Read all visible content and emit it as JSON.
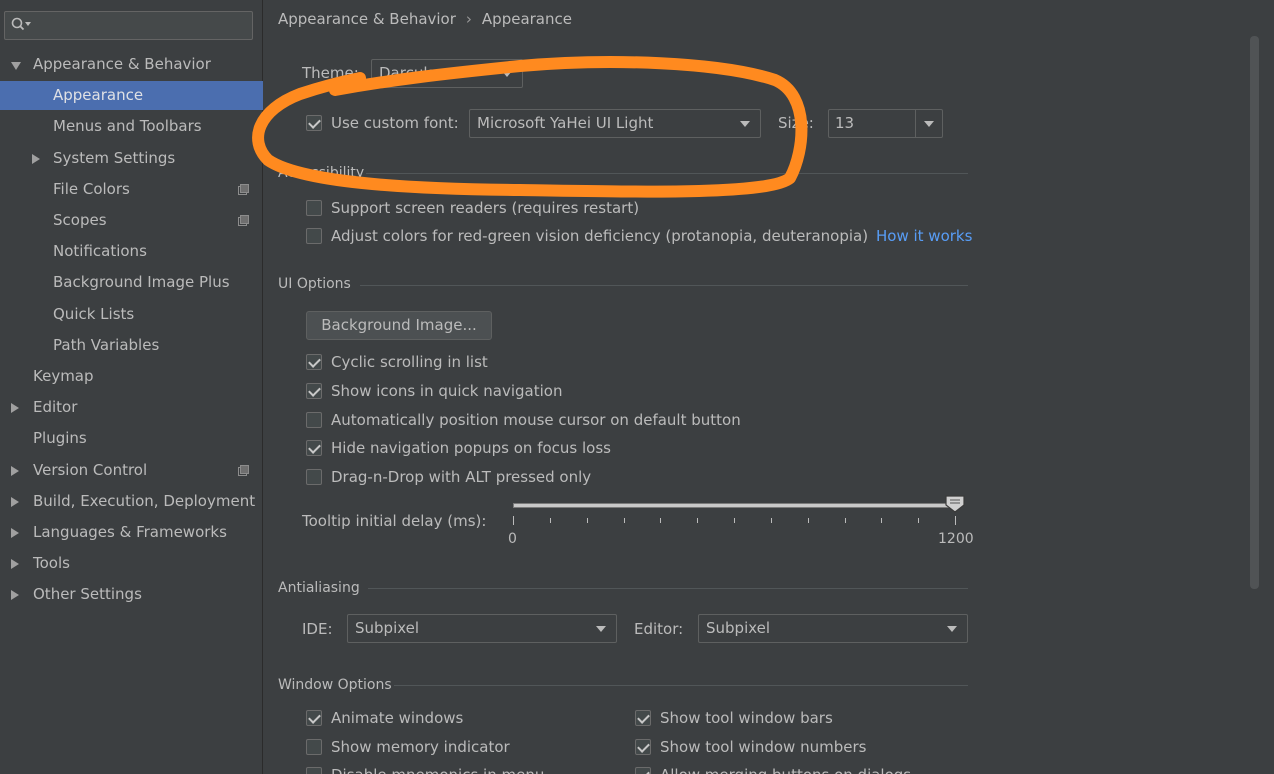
{
  "sidebar": {
    "search": {
      "placeholder": "",
      "icon": "search-icon"
    },
    "items": [
      {
        "label": "Appearance & Behavior",
        "level": 0,
        "arrow": "expanded"
      },
      {
        "label": "Appearance",
        "level": 1,
        "selected": true
      },
      {
        "label": "Menus and Toolbars",
        "level": 1
      },
      {
        "label": "System Settings",
        "level": 1,
        "arrow": "collapsed"
      },
      {
        "label": "File Colors",
        "level": 1,
        "project_icon": true
      },
      {
        "label": "Scopes",
        "level": 1,
        "project_icon": true
      },
      {
        "label": "Notifications",
        "level": 1
      },
      {
        "label": "Background Image Plus",
        "level": 1
      },
      {
        "label": "Quick Lists",
        "level": 1
      },
      {
        "label": "Path Variables",
        "level": 1
      },
      {
        "label": "Keymap",
        "level": 0
      },
      {
        "label": "Editor",
        "level": 0,
        "arrow": "collapsed"
      },
      {
        "label": "Plugins",
        "level": 0
      },
      {
        "label": "Version Control",
        "level": 0,
        "arrow": "collapsed",
        "project_icon": true
      },
      {
        "label": "Build, Execution, Deployment",
        "level": 0,
        "arrow": "collapsed"
      },
      {
        "label": "Languages & Frameworks",
        "level": 0,
        "arrow": "collapsed"
      },
      {
        "label": "Tools",
        "level": 0,
        "arrow": "collapsed"
      },
      {
        "label": "Other Settings",
        "level": 0,
        "arrow": "collapsed"
      }
    ]
  },
  "breadcrumb": {
    "parent": "Appearance & Behavior",
    "separator": "›",
    "current": "Appearance"
  },
  "theme": {
    "label": "Theme:",
    "value": "Darcula"
  },
  "custom_font": {
    "label": "Use custom font:",
    "checked": true,
    "font": "Microsoft YaHei UI Light",
    "size_label": "Size:",
    "size": "13"
  },
  "accessibility": {
    "title": "Accessibility",
    "screen_readers": {
      "label": "Support screen readers (requires restart)",
      "checked": false
    },
    "adjust_colors": {
      "label": "Adjust colors for red-green vision deficiency (protanopia, deuteranopia)",
      "checked": false,
      "link": "How it works"
    }
  },
  "ui_options": {
    "title": "UI Options",
    "background_button": "Background Image...",
    "checkboxes": [
      {
        "label": "Cyclic scrolling in list",
        "checked": true
      },
      {
        "label": "Show icons in quick navigation",
        "checked": true
      },
      {
        "label": "Automatically position mouse cursor on default button",
        "checked": false
      },
      {
        "label": "Hide navigation popups on focus loss",
        "checked": true
      },
      {
        "label": "Drag-n-Drop with ALT pressed only",
        "checked": false
      }
    ],
    "tooltip_delay": {
      "label": "Tooltip initial delay (ms):",
      "min": "0",
      "max": "1200",
      "value": 1200
    }
  },
  "antialiasing": {
    "title": "Antialiasing",
    "ide_label": "IDE:",
    "ide_value": "Subpixel",
    "editor_label": "Editor:",
    "editor_value": "Subpixel"
  },
  "window_options": {
    "title": "Window Options",
    "left": [
      {
        "label": "Animate windows",
        "checked": true
      },
      {
        "label": "Show memory indicator",
        "checked": false
      },
      {
        "label": "Disable mnemonics in menu",
        "checked": false
      }
    ],
    "right": [
      {
        "label": "Show tool window bars",
        "checked": true
      },
      {
        "label": "Show tool window numbers",
        "checked": true
      },
      {
        "label": "Allow merging buttons on dialogs",
        "checked": true
      }
    ]
  },
  "colors": {
    "selection": "#4b6eaf",
    "link": "#589df6",
    "annotation": "#ff8a1f",
    "background": "#3c3f41"
  }
}
